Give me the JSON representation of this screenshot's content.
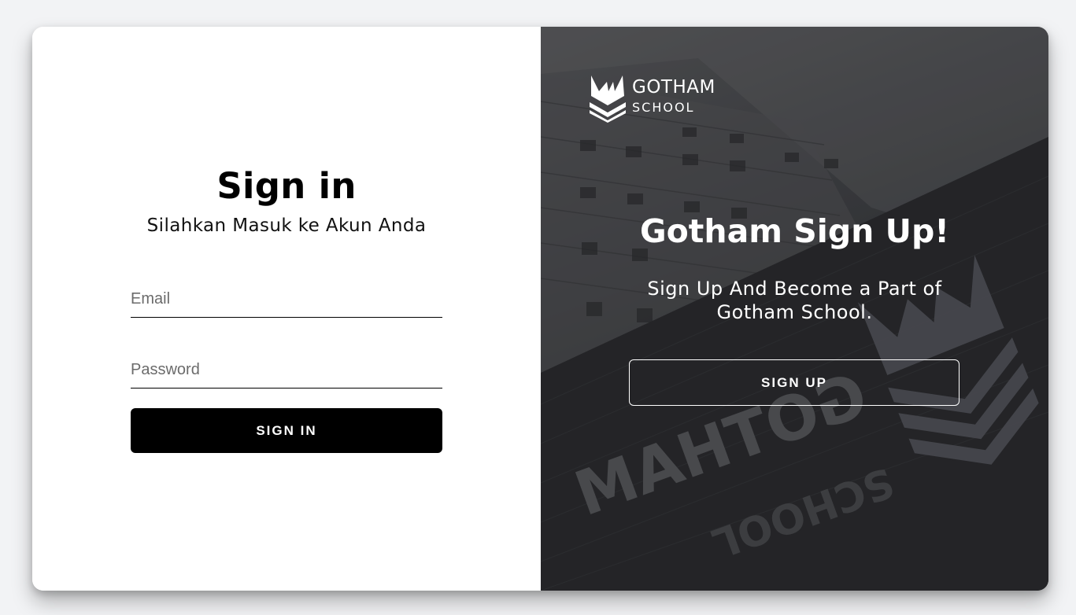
{
  "signin": {
    "title": "Sign in",
    "subtitle": "Silahkan Masuk ke Akun Anda",
    "email_placeholder": "Email",
    "password_placeholder": "Password",
    "button_label": "SIGN IN"
  },
  "signup": {
    "logo_line1": "GOTHAM",
    "logo_line2": "SCHOOL",
    "title": "Gotham Sign Up!",
    "description": "Sign Up And Become a Part of Gotham School.",
    "button_label": "SIGN UP",
    "bg_sign_text1": "GOTHAM",
    "bg_sign_text2": "SCHOOL"
  },
  "colors": {
    "page_bg": "#f2f3f5",
    "primary_button": "#000000",
    "panel_dark": "#3d3f43",
    "text_light": "#ffffff"
  }
}
